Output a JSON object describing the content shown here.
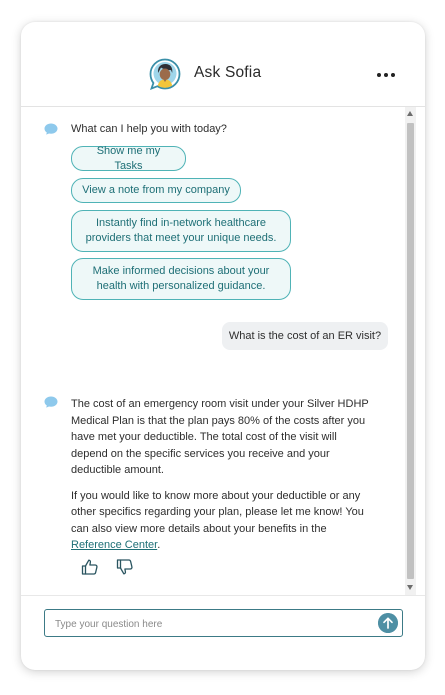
{
  "header": {
    "title": "Ask Sofia",
    "avatar_icon": "assistant-avatar-icon",
    "menu_icon": "more-horizontal-icon"
  },
  "chat": {
    "greeting": "What can I help you with today?",
    "suggestions": [
      "Show me my Tasks",
      "View a note from my company",
      "Instantly find in-network healthcare providers that meet your unique needs.",
      "Make informed decisions about your health with personalized guidance."
    ],
    "user_message": "What is the cost of an ER visit?",
    "answer_paragraph_1": "The cost of an emergency room visit under your Silver HDHP Medical Plan is that the plan pays 80% of the costs after you have met your deductible. The total cost of the visit will depend on the specific services you receive and your deductible amount.",
    "answer_paragraph_2": "If you would like to know more about your deductible or any other specifics regarding your plan, please let me know! You can also view more details about your benefits in the",
    "answer_link": "Reference Center",
    "answer_link_suffix": ".",
    "feedback": {
      "thumbs_up_icon": "thumbs-up-icon",
      "thumbs_down_icon": "thumbs-down-icon"
    }
  },
  "composer": {
    "placeholder": "Type your question here",
    "send_icon": "arrow-up-icon"
  },
  "colors": {
    "accent": "#4fb3b6",
    "chip_text": "#1e6f76",
    "chip_bg": "#eef8f8",
    "send_button": "#4e8fa4",
    "bot_icon": "#8ec9ec",
    "user_bubble": "#eef0f2"
  }
}
